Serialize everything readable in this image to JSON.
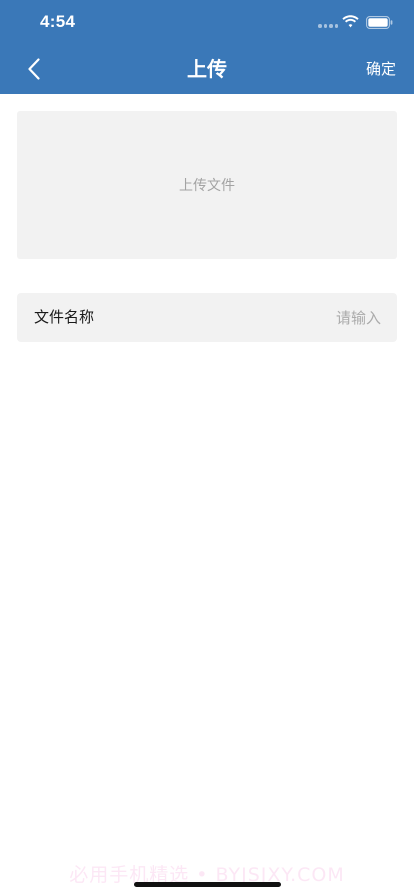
{
  "status_bar": {
    "time": "4:54",
    "icons": [
      "signal-dots-icon",
      "wifi-icon",
      "battery-icon"
    ]
  },
  "nav": {
    "back_icon": "chevron-left-icon",
    "title": "上传",
    "confirm_label": "确定",
    "background": "#3a78b8"
  },
  "upload": {
    "label": "上传文件"
  },
  "file_name": {
    "label": "文件名称",
    "value": "",
    "placeholder": "请输入"
  },
  "watermark": "必用手机精选 • BYJSJXY.COM"
}
